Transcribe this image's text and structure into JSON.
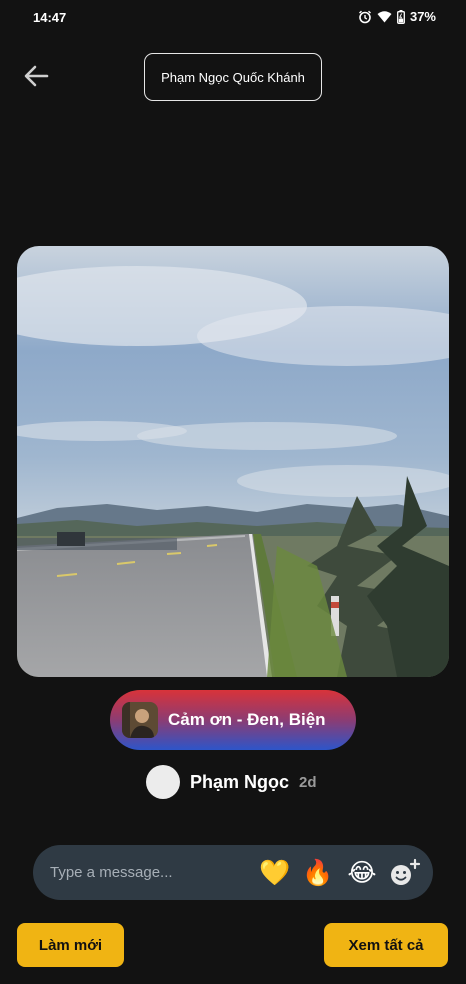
{
  "status": {
    "time": "14:47",
    "battery": "37%"
  },
  "header": {
    "title": "Phạm Ngọc Quốc Khánh",
    "back_icon": "arrow-left-icon"
  },
  "music": {
    "title": "Cảm ơn - Đen, Biện",
    "gradient": [
      "#d8333a",
      "#2d55c9"
    ]
  },
  "post": {
    "author": "Phạm Ngọc",
    "time_ago": "2d"
  },
  "composer": {
    "placeholder": "Type a message...",
    "reactions": [
      "💛",
      "🔥",
      "😂"
    ]
  },
  "actions": {
    "refresh_label": "Làm mới",
    "view_all_label": "Xem tất cả"
  },
  "colors": {
    "background": "#121212",
    "accent": "#f0b413",
    "composer_bg": "#2f3a44"
  }
}
